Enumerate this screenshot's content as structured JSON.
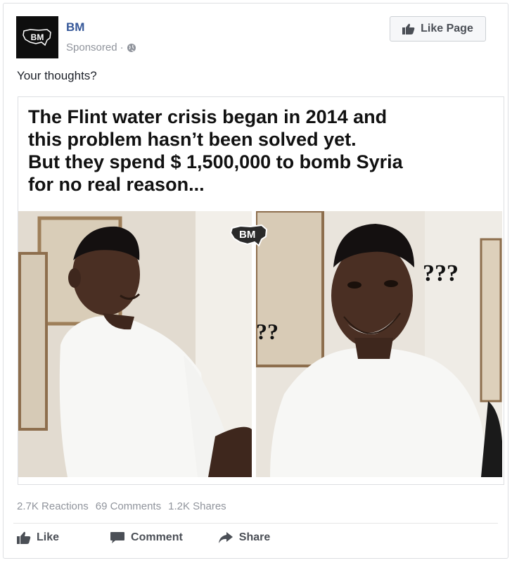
{
  "header": {
    "page_name": "BM",
    "avatar_text": "BM",
    "sponsored_label": "Sponsored",
    "separator": "·",
    "privacy_icon": "globe-icon",
    "like_page_label": "Like Page",
    "like_page_icon": "thumbs-up-icon"
  },
  "post": {
    "text": "Your thoughts?"
  },
  "media": {
    "caption_lines": [
      "The Flint water crisis began in 2014 and",
      "this problem hasn’t been solved yet.",
      "But  they spend $ 1,500,000 to bomb Syria",
      "for no real reason..."
    ],
    "watermark_text": "BM",
    "question_marks_left": "??",
    "question_marks_right": "???"
  },
  "stats": {
    "reactions": "2.7K Reactions",
    "comments": "69 Comments",
    "shares": "1.2K Shares"
  },
  "actions": {
    "like_label": "Like",
    "like_icon": "thumbs-up-icon",
    "comment_label": "Comment",
    "comment_icon": "speech-bubble-icon",
    "share_label": "Share",
    "share_icon": "share-arrow-icon"
  },
  "colors": {
    "link_blue": "#365899",
    "muted_gray": "#90949c",
    "action_gray": "#4b4f56",
    "border": "#dddfe2"
  }
}
